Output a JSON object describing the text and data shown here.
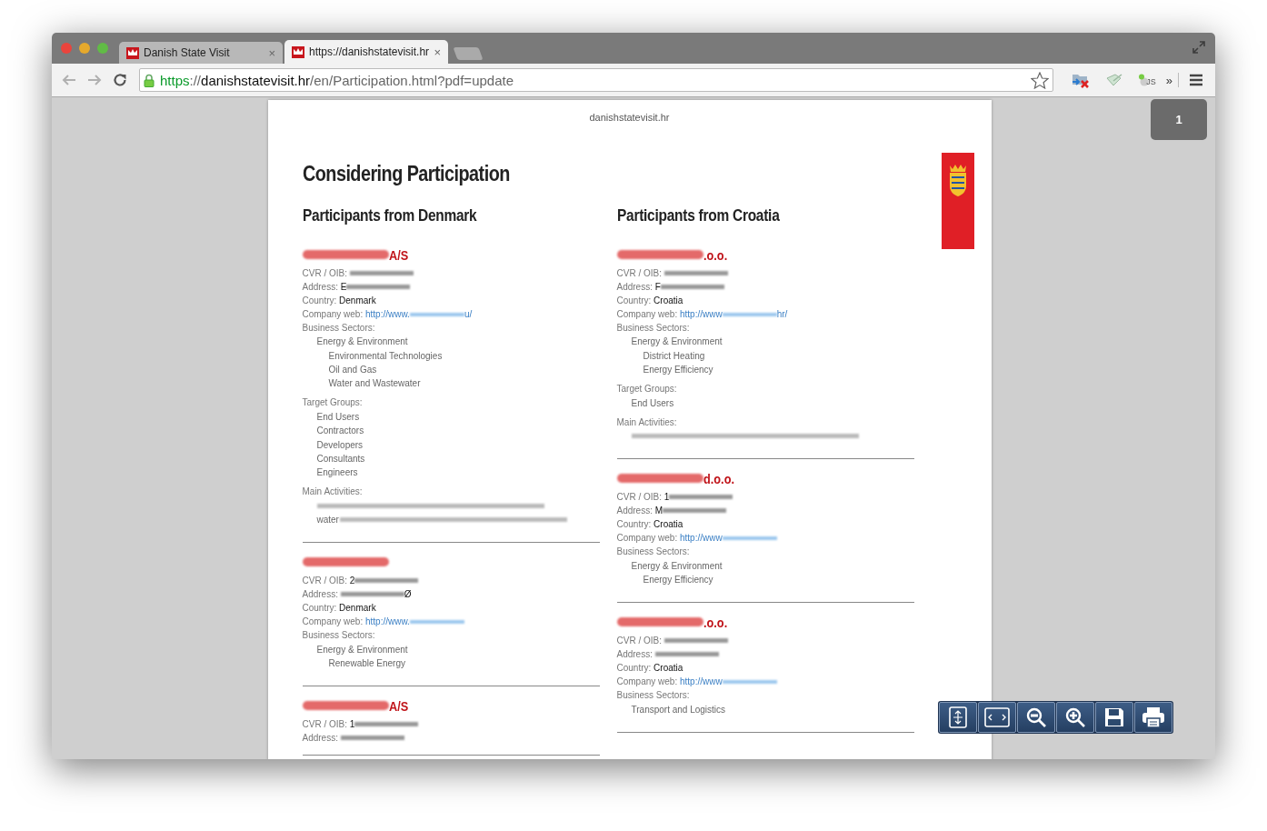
{
  "window": {
    "tabs": [
      {
        "title": "Danish State Visit",
        "close": "×",
        "selected": false
      },
      {
        "title": "https://danishstatevisit.hr",
        "close": "×",
        "selected": true
      }
    ],
    "address_bar": {
      "scheme": "https",
      "separator": "://",
      "host": "danishstatevisit.hr",
      "path": "/en/Participation.html?pdf=update",
      "secure": true
    },
    "extension_badge": "JS",
    "extensions_overflow": "»"
  },
  "viewer": {
    "page_number": "1",
    "page": {
      "header": "danishstatevisit.hr",
      "title": "Considering Participation",
      "columns": [
        {
          "heading": "Participants from Denmark",
          "companies": [
            {
              "name_suffix": "A/S",
              "fields": [
                {
                  "label": "CVR / OIB:",
                  "kind": "text",
                  "redacted": true
                },
                {
                  "label": "Address:",
                  "kind": "text",
                  "value": "E",
                  "redacted": true
                },
                {
                  "label": "Country:",
                  "kind": "text",
                  "value": "Denmark",
                  "redacted": false
                },
                {
                  "label": "Company web:",
                  "kind": "link",
                  "value": "http://www.",
                  "redacted": true,
                  "after": "u/"
                }
              ],
              "sections": [
                {
                  "label": "Business Sectors:",
                  "items": [
                    {
                      "label": "Energy & Environment",
                      "children": [
                        {
                          "label": "Environmental Technologies"
                        },
                        {
                          "label": "Oil and Gas"
                        },
                        {
                          "label": "Water and Wastewater"
                        }
                      ]
                    }
                  ]
                },
                {
                  "label": "Target Groups:",
                  "items": [
                    {
                      "label": "End Users"
                    },
                    {
                      "label": "Contractors"
                    },
                    {
                      "label": "Developers"
                    },
                    {
                      "label": "Consultants"
                    },
                    {
                      "label": "Engineers"
                    }
                  ]
                },
                {
                  "label": "Main Activities:",
                  "items": [
                    {
                      "redacted": true
                    },
                    {
                      "label": "water",
                      "redacted": true
                    }
                  ]
                }
              ]
            },
            {
              "fields": [
                {
                  "label": "CVR / OIB:",
                  "kind": "text",
                  "value": "2",
                  "redacted": true
                },
                {
                  "label": "Address:",
                  "kind": "text",
                  "redacted": true,
                  "after": "Ø"
                },
                {
                  "label": "Country:",
                  "kind": "text",
                  "value": "Denmark",
                  "redacted": false
                },
                {
                  "label": "Company web:",
                  "kind": "link",
                  "value": "http://www.",
                  "redacted": true
                }
              ],
              "sections": [
                {
                  "label": "Business Sectors:",
                  "items": [
                    {
                      "label": "Energy & Environment",
                      "children": [
                        {
                          "label": "Renewable Energy"
                        }
                      ]
                    }
                  ]
                }
              ]
            },
            {
              "name_suffix": "A/S",
              "fields": [
                {
                  "label": "CVR / OIB:",
                  "kind": "text",
                  "value": "1",
                  "redacted": true
                },
                {
                  "label": "Address:",
                  "kind": "text",
                  "redacted": true
                }
              ]
            }
          ]
        },
        {
          "heading": "Participants from Croatia",
          "companies": [
            {
              "name_suffix": ".o.o.",
              "fields": [
                {
                  "label": "CVR / OIB:",
                  "kind": "text",
                  "redacted": true
                },
                {
                  "label": "Address:",
                  "kind": "text",
                  "value": "F",
                  "redacted": true
                },
                {
                  "label": "Country:",
                  "kind": "text",
                  "value": "Croatia",
                  "redacted": false
                },
                {
                  "label": "Company web:",
                  "kind": "link",
                  "value": "http://www",
                  "redacted": true,
                  "after": "hr/"
                }
              ],
              "sections": [
                {
                  "label": "Business Sectors:",
                  "items": [
                    {
                      "label": "Energy & Environment",
                      "children": [
                        {
                          "label": "District Heating"
                        },
                        {
                          "label": "Energy Efficiency"
                        }
                      ]
                    }
                  ]
                },
                {
                  "label": "Target Groups:",
                  "items": [
                    {
                      "label": "End Users"
                    }
                  ]
                },
                {
                  "label": "Main Activities:",
                  "items": [
                    {
                      "redacted": true
                    }
                  ]
                }
              ]
            },
            {
              "name_suffix": "d.o.o.",
              "fields": [
                {
                  "label": "CVR / OIB:",
                  "kind": "text",
                  "value": "1",
                  "redacted": true
                },
                {
                  "label": "Address:",
                  "kind": "text",
                  "value": "M",
                  "redacted": true
                },
                {
                  "label": "Country:",
                  "kind": "text",
                  "value": "Croatia",
                  "redacted": false
                },
                {
                  "label": "Company web:",
                  "kind": "link",
                  "value": "http://www",
                  "redacted": true
                }
              ],
              "sections": [
                {
                  "label": "Business Sectors:",
                  "items": [
                    {
                      "label": "Energy & Environment",
                      "children": [
                        {
                          "label": "Energy Efficiency"
                        }
                      ]
                    }
                  ]
                }
              ]
            },
            {
              "name_suffix": ".o.o.",
              "fields": [
                {
                  "label": "CVR / OIB:",
                  "kind": "text",
                  "redacted": true
                },
                {
                  "label": "Address:",
                  "kind": "text",
                  "redacted": true
                },
                {
                  "label": "Country:",
                  "kind": "text",
                  "value": "Croatia",
                  "redacted": false
                },
                {
                  "label": "Company web:",
                  "kind": "link",
                  "value": "http://www",
                  "redacted": true
                }
              ],
              "sections": [
                {
                  "label": "Business Sectors:",
                  "items": [
                    {
                      "label": "Transport and Logistics"
                    }
                  ]
                }
              ]
            }
          ]
        }
      ]
    }
  }
}
